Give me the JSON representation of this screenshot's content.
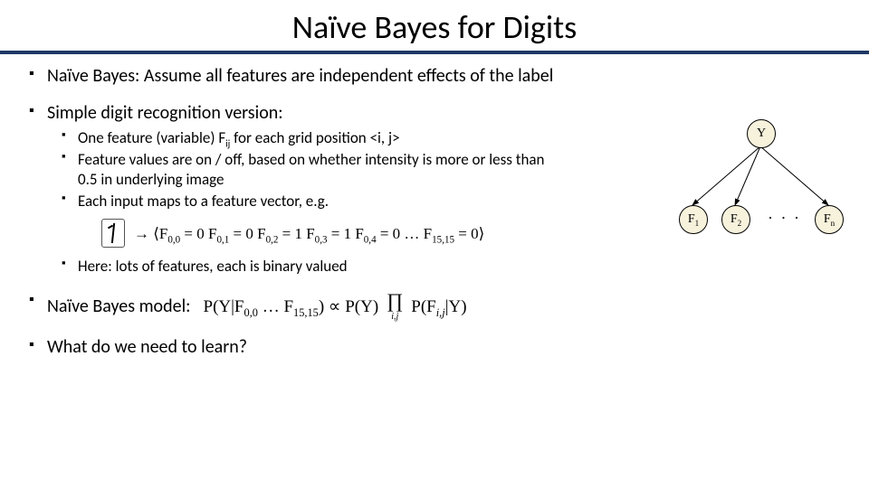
{
  "title": "Naïve Bayes for Digits",
  "b1": "Naïve Bayes: Assume all features are independent effects of the label",
  "b2": "Simple digit recognition version:",
  "s1_a": "One feature (variable) F",
  "s1_b": " for each grid position <i, j>",
  "s2": "Feature values are on / off, based on whether intensity is more or less than 0.5 in underlying image",
  "s3": "Each input maps to a feature vector, e.g.",
  "formula_arrow": "→ ⟨F",
  "formula_rest1": " = 0   F",
  "formula_rest2": " = 0   F",
  "formula_rest3": " = 1   F",
  "formula_rest4": " = 1   F",
  "formula_rest5": " = 0   …  F",
  "formula_rest6": " = 0⟩",
  "idx00": "0,0",
  "idx01": "0,1",
  "idx02": "0,2",
  "idx03": "0,3",
  "idx04": "0,4",
  "idx1515": "15,15",
  "s4": "Here: lots of features, each is binary valued",
  "b3": "Naïve Bayes model:",
  "nb_lhs": "P(Y|F",
  "nb_lhs2": " … F",
  "nb_lhs3": ") ∝ P(Y)",
  "nb_prod": "∏",
  "nb_prod_sub": "i,j",
  "nb_rhs": "P(F",
  "nb_rhs2": "|Y)",
  "b4": "What do we need to learn?",
  "diagram": {
    "Y": "Y",
    "F1": "F",
    "F1s": "1",
    "F2": "F",
    "F2s": "2",
    "Fn": "F",
    "Fns": "n",
    "dots": "· · ·"
  }
}
